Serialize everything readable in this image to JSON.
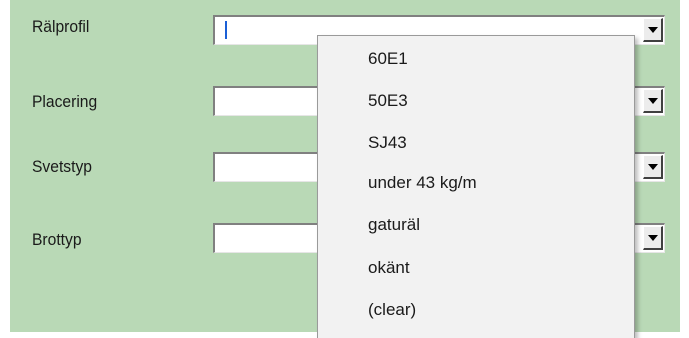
{
  "form": {
    "fields": [
      {
        "label": "Rälprofil",
        "value": ""
      },
      {
        "label": "Placering",
        "value": ""
      },
      {
        "label": "Svetstyp",
        "value": ""
      },
      {
        "label": "Brottyp",
        "value": ""
      }
    ]
  },
  "dropdown": {
    "options": [
      "60E1",
      "50E3",
      "SJ43",
      "under 43 kg/m",
      "gaturäl",
      "okänt",
      "(clear)"
    ]
  },
  "icons": {
    "combo_arrow": "chevron-down-icon"
  },
  "colors": {
    "panel_background": "#b9d9b6",
    "dropdown_background": "#f2f2f2",
    "caret": "#1a5fd6"
  }
}
